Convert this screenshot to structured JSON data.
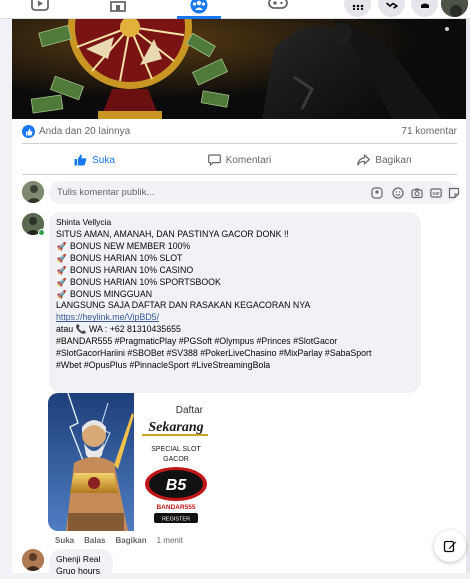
{
  "top_nav": {
    "icons": [
      "watch-icon",
      "marketplace-icon",
      "groups-icon",
      "gaming-icon"
    ],
    "active": "groups-icon",
    "right": [
      "menu-grid-icon",
      "messenger-icon",
      "notifications-icon"
    ]
  },
  "post": {
    "stats": {
      "likes": "Anda dan 20 lainnya",
      "comments": "71 komentar"
    },
    "actions": {
      "like": "Suka",
      "comment": "Komentari",
      "share": "Bagikan"
    },
    "composer_placeholder": "Tulis komentar publik..."
  },
  "comment": {
    "author": "Shinta Vellycia",
    "lines": [
      "SITUS AMAN, AMANAH, DAN PASTINYA GACOR DONK !!",
      "BONUS NEW MEMBER 100%",
      "BONUS HARIAN 10% SLOT",
      "BONUS HARIAN 10% CASINO",
      "BONUS HARIAN 10% SPORTSBOOK",
      "BONUS MINGGUAN",
      "LANGSUNG SAJA DAFTAR DAN RASAKAN KEGACORAN NYA",
      "https://heylink.me/VipBD5/",
      "atau",
      "WA : +62 81310435655",
      "#BANDAR555 #PragmaticPlay #PGSoft #Olympus #Princes #SlotGacor",
      "#SlotGacorHariini #SBOBet #SV388 #PokerLiveChasino #MixParlay #SabaSport",
      "#Wbet #OpusPlus #PinnacleSport #LiveStreamingBola"
    ],
    "image": {
      "daftar": "Daftar",
      "sekarang": "Sekarang",
      "special1": "SPECIAL SLOT",
      "special2": "GACOR",
      "logo_text": "BANDAR555",
      "register": "REGISTER"
    },
    "reactions": {
      "like": "Suka",
      "reply": "Balas",
      "share": "Bagikan",
      "time": "1 menit"
    }
  },
  "comment2": {
    "author": "Ghenji Real",
    "text": "Gruo hours"
  },
  "colors": {
    "accent": "#1877f2",
    "link": "#385898",
    "muted": "#65676b",
    "bubble": "#f0f2f5"
  }
}
